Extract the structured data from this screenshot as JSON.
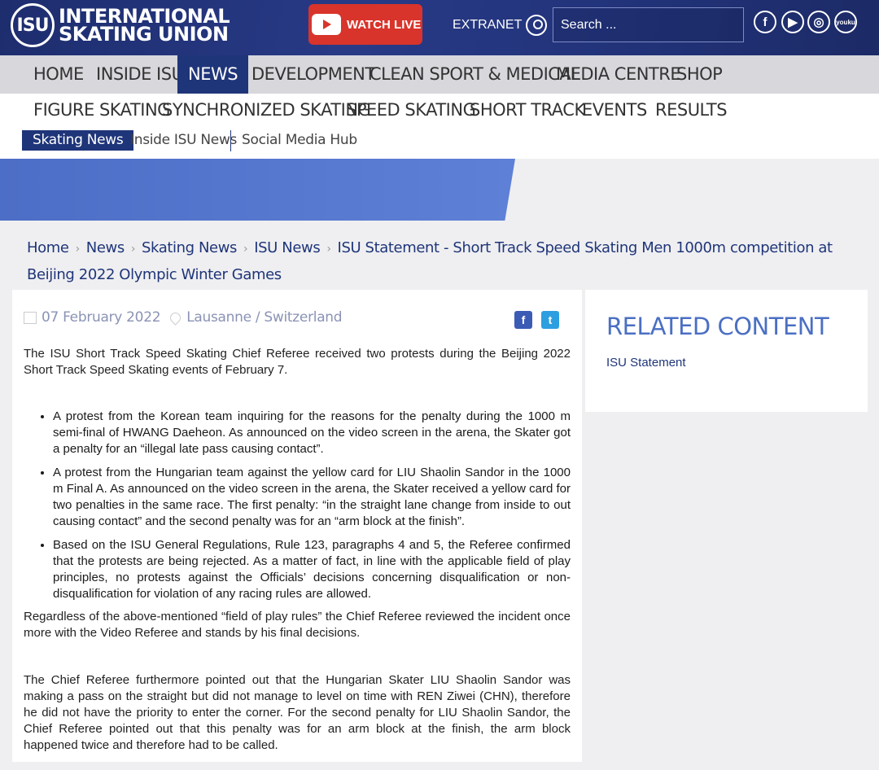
{
  "header": {
    "logo_mark": "ISU",
    "logo_line1": "INTERNATIONAL",
    "logo_line2": "SKATING UNION",
    "watch_live": "WATCH LIVE",
    "extranet": "EXTRANET",
    "search_placeholder": "Search ...",
    "social": [
      "facebook-icon",
      "youtube-icon",
      "weibo-icon",
      "youku-icon"
    ]
  },
  "main_nav": {
    "items": [
      "HOME",
      "INSIDE ISU",
      "NEWS",
      "DEVELOPMENT",
      "CLEAN SPORT & MEDICAL",
      "MEDIA CENTRE",
      "SHOP"
    ],
    "active": "NEWS"
  },
  "sub_nav": {
    "items": [
      "FIGURE SKATING",
      "SYNCHRONIZED SKATING",
      "SPEED SKATING",
      "SHORT TRACK",
      "EVENTS",
      "RESULTS"
    ],
    "news_tabs": [
      "Skating News",
      "Inside ISU News",
      "Social Media Hub"
    ],
    "active_tab": "Skating News"
  },
  "breadcrumb": [
    "Home",
    "News",
    "Skating News",
    "ISU News",
    "ISU Statement - Short Track Speed Skating Men 1000m competition at Beijing 2022 Olympic Winter Games"
  ],
  "article": {
    "date": "07 February 2022",
    "location": "Lausanne / Switzerland",
    "intro": "The ISU Short Track Speed Skating Chief Referee received two protests during the Beijing 2022 Short Track Speed Skating events of February 7.",
    "bullets": [
      "A protest from the Korean team inquiring for the reasons for the penalty during the 1000 m semi-final of HWANG Daeheon. As announced on the video screen in the arena, the Skater got a penalty for an “illegal late pass causing contact”.",
      "A protest from the Hungarian team against the yellow card for LIU Shaolin Sandor in the 1000 m Final A. As announced on the video screen in the arena, the Skater received a yellow card for two penalties in the same race. The first penalty: “in the straight lane change from inside to out causing contact” and the second penalty was for an “arm block at the finish”.",
      "Based on the ISU General Regulations, Rule 123, paragraphs 4 and 5, the Referee confirmed that the protests are being rejected. As a matter of fact, in line with the applicable field of play principles, no protests against the Officials’ decisions concerning disqualification or non-disqualification for violation of any racing rules are allowed."
    ],
    "para2": "Regardless of the above-mentioned “field of play rules” the Chief Referee reviewed the incident once more with the Video Referee and stands by his final decisions.",
    "para3": "The Chief Referee furthermore pointed out that the Hungarian Skater LIU Shaolin Sandor was making a pass on the straight but did not manage to level on time with REN Ziwei (CHN), therefore he did not have the priority to enter the corner. For the second penalty for LIU Shaolin Sandor, the Chief Referee pointed out that this penalty was for an arm block at the finish, the arm block happened twice and therefore had to be called."
  },
  "related": {
    "title": "RELATED CONTENT",
    "link": "ISU Statement"
  },
  "colors": {
    "brand_navy": "#1f3579",
    "accent_blue": "#4b6fc3",
    "live_red": "#d8342b",
    "facebook": "#3b5bb5",
    "twitter": "#2c9fe0"
  }
}
